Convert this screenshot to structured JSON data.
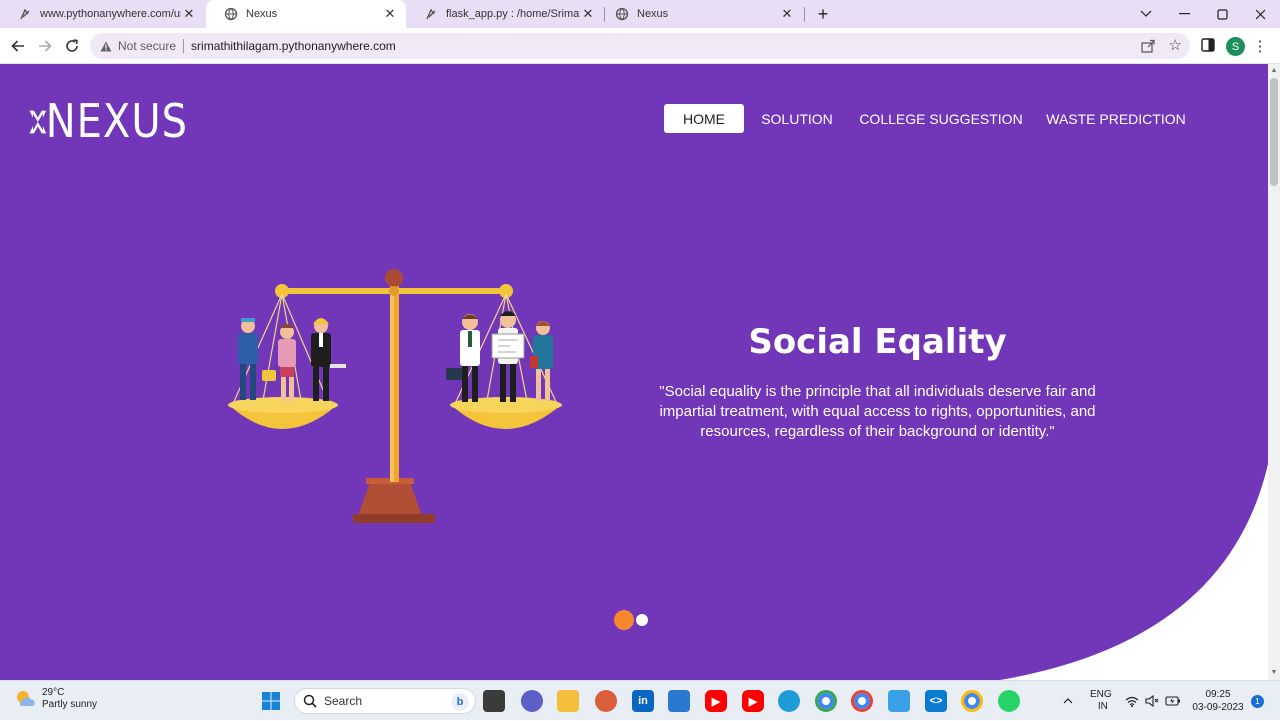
{
  "browser": {
    "tabs": [
      {
        "title": "www.pythonanywhere.com/user/",
        "icon": "python-anywhere-icon",
        "active": false
      },
      {
        "title": "Nexus",
        "icon": "globe-icon",
        "active": true
      },
      {
        "title": "flask_app.py : /home/SrimathiThil",
        "icon": "python-anywhere-icon",
        "active": false
      },
      {
        "title": "Nexus",
        "icon": "globe-icon",
        "active": false
      }
    ],
    "security_label": "Not secure",
    "url": "srimathithilagam.pythonanywhere.com",
    "profile_initial": "S"
  },
  "site": {
    "logo_text": "NEXUS",
    "nav": [
      {
        "label": "HOME",
        "active": true
      },
      {
        "label": "SOLUTION",
        "active": false
      },
      {
        "label": "COLLEGE SUGGESTION",
        "active": false
      },
      {
        "label": "WASTE PREDICTION",
        "active": false
      }
    ],
    "slide": {
      "title": "Social Eqality",
      "quote": "\"Social equality is the principle that all individuals deserve fair and impartial treatment, with equal access to rights, opportunities, and resources, regardless of their background or identity.\"",
      "illustration": "balance-scale-people",
      "active_index": 1,
      "count": 2
    },
    "colors": {
      "hero_bg": "#7236b9",
      "active_dot": "#f7872e",
      "inactive_dot": "#ffffff"
    }
  },
  "taskbar": {
    "weather_temp": "29°C",
    "weather_desc": "Partly sunny",
    "search_placeholder": "Search",
    "language_top": "ENG",
    "language_bottom": "IN",
    "time": "09:25",
    "date": "03-09-2023",
    "notification_count": "1"
  }
}
